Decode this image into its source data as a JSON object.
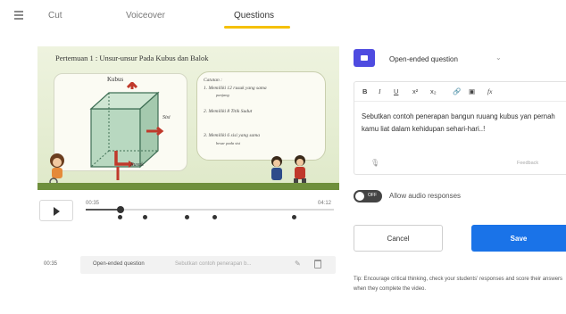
{
  "nav": {
    "tabs": [
      {
        "label": "Cut"
      },
      {
        "label": "Voiceover"
      },
      {
        "label": "Questions",
        "active": true
      }
    ],
    "accent_color": "#f5c000"
  },
  "video": {
    "slide_title": "Pertemuan 1 : Unsur-unsur Pada Kubus dan Balok",
    "kubus_label": "Kubus",
    "sisi_label": "Sisi",
    "rusuk_label": "Rusuk",
    "notes": [
      "Catatan :",
      "1. Memiliki 12 rusuk yang sama",
      "panjang",
      "2. Memiliki 8 Titik Sudut",
      "3. Memiliki 6 sisi yang sama",
      "besar pada sisi"
    ]
  },
  "player": {
    "play_icon": "play-icon",
    "current_time": "00:35",
    "duration": "04:12",
    "progress_fraction": 0.14,
    "question_markers_fraction": [
      0.14,
      0.24,
      0.41,
      0.52,
      0.84
    ]
  },
  "question_list": [
    {
      "time": "00:35",
      "type": "Open-ended question",
      "preview": "Sebutkan contoh penerapan b...",
      "edit_icon": "pencil-icon",
      "delete_icon": "trash-icon"
    }
  ],
  "editor": {
    "question_type": "Open-ended question",
    "question_type_color": "#4e4be0",
    "toolbar": [
      "B",
      "I",
      "U",
      "x²",
      "x₂",
      "🔗",
      "▣",
      "fx"
    ],
    "text": "Sebutkan contoh penerapan bangun ruuang kubus yan pernah kamu liat dalam kehidupan sehari-hari..!",
    "mic_icon": "mic-icon",
    "feedback_label": "Feedback"
  },
  "audio_toggle": {
    "state_label": "OFF",
    "label": "Allow audio responses"
  },
  "actions": {
    "cancel": "Cancel",
    "save": "Save",
    "save_color": "#1a73e8"
  },
  "tip": "Tip: Encourage critical thinking, check your students' responses and score their answers when they complete the video."
}
